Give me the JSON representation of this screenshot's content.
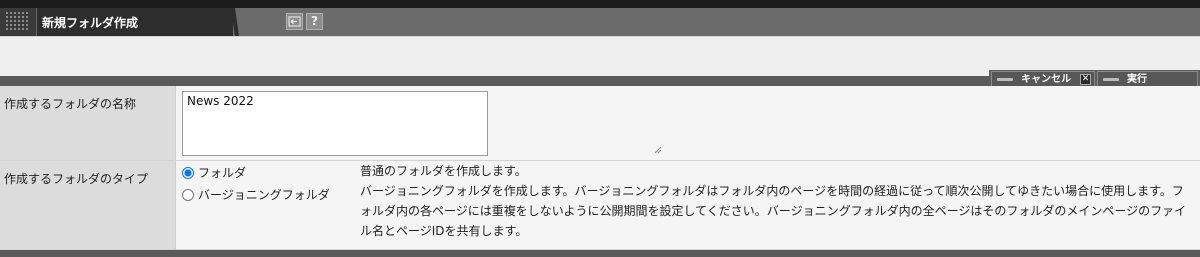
{
  "window": {
    "title": "新規フォルダ作成",
    "toolbar": {
      "back_icon": "back-arrow-icon",
      "help_label": "?"
    }
  },
  "actions": {
    "cancel_label": "キャンセル",
    "execute_label": "実行"
  },
  "form": {
    "name_label": "作成するフォルダの名称",
    "name_value": "News 2022",
    "type_label": "作成するフォルダのタイプ",
    "options": [
      {
        "label": "フォルダ",
        "selected": true,
        "description": "普通のフォルダを作成します。"
      },
      {
        "label": "バージョニングフォルダ",
        "selected": false,
        "description": "バージョニングフォルダを作成します。バージョニングフォルダはフォルダ内のページを時間の経過に従って順次公開してゆきたい場合に使用します。フォルダ内の各ページには重複をしないように公開期間を設定してください。バージョニングフォルダ内の全ページはそのフォルダのメインページのファイル名とページIDを共有します。"
      }
    ]
  },
  "colors": {
    "titlebar": "#6b6b6b",
    "tab": "#2d2d2d",
    "separator": "#5a5a5a"
  }
}
